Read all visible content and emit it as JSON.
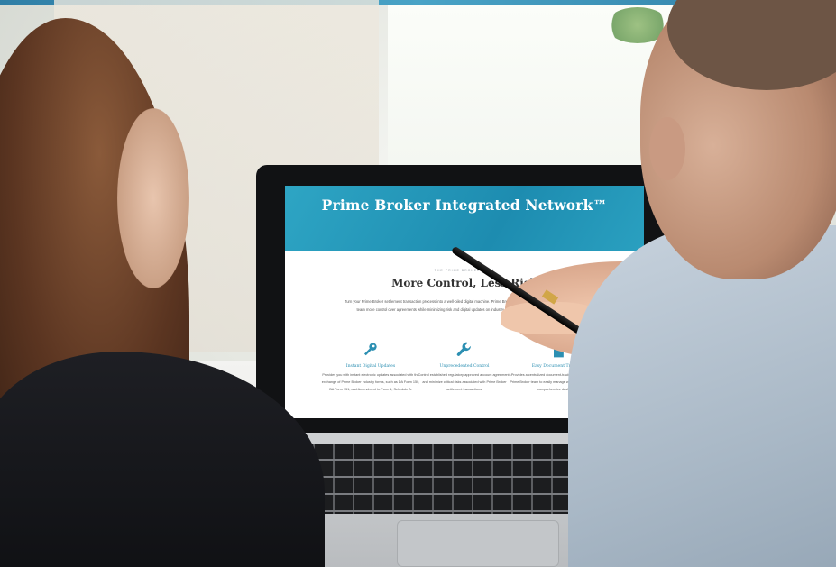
{
  "site": {
    "hero_title": "Prime Broker Integrated Network™",
    "eyebrow": "THE PRIME BROKER TEAM",
    "section_title": "More Control, Less Risk",
    "intro": "Turn your Prime Broker settlement transaction process into a well-oiled digital machine. Prime Broker Interactive is an online tool that gives your team more control over agreements while minimizing risk and digital updates on industry forms, staying compliant becomes easy.",
    "features": [
      {
        "icon": "key-icon",
        "title": "Instant Digital Updates",
        "text": "Provides you with instant electronic updates associated with the exchange of Prime Broker industry forms, such as DA Form 150, BA Form 151, and Amendment to Form 1, Schedule A."
      },
      {
        "icon": "wrench-icon",
        "title": "Unprecedented Control",
        "text": "Control established regulatory-approved account agreements and minimize critical risks associated with Prime Broker settlement transactions."
      },
      {
        "icon": "document-icon",
        "title": "Easy Document Tracking",
        "text": "Provides a centralized document-tracking tool that allows your Prime Broker team to easily manage workflows via the system's comprehensive dashboard."
      }
    ]
  },
  "colors": {
    "hero": "#1d8cb0",
    "accent": "#2c8fb2",
    "stripe": "#2f7ea6"
  }
}
